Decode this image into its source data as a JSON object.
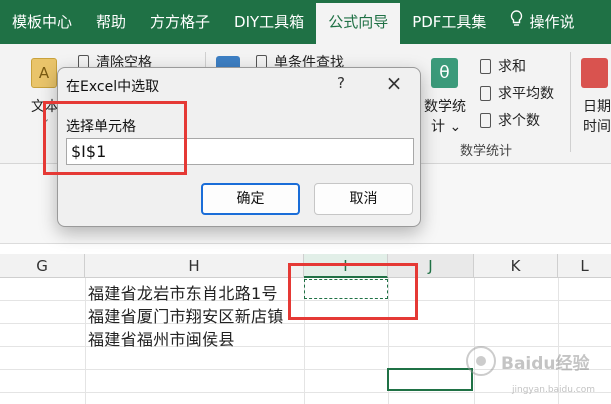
{
  "ribbon_tabs": [
    "模板中心",
    "帮助",
    "方方格子",
    "DIY工具箱",
    "公式向导",
    "PDF工具集",
    "操作说"
  ],
  "active_tab": "公式向导",
  "ribbon": {
    "text_btn": "文本",
    "text_chevron": "⌄",
    "clear_space": "清除空格",
    "single_cond_lookup": "单条件查找",
    "math_stats": "数学统",
    "math_stats_2": "计 ⌄",
    "sum": "求和",
    "average": "求平均数",
    "count": "求个数",
    "group_label": "数学统计",
    "date": "日期",
    "time": "时间"
  },
  "grid": {
    "columns": [
      "G",
      "H",
      "I",
      "J",
      "K",
      "L"
    ],
    "selected_column": "I",
    "rows": [
      "福建省龙岩市东肖北路1号",
      "福建省厦门市翔安区新店镇",
      "福建省福州市闽侯县"
    ]
  },
  "dialog": {
    "title": "在Excel中选取",
    "help": "?",
    "close": "×",
    "label": "选择单元格",
    "value": "$I$1",
    "ok": "确定",
    "cancel": "取消"
  },
  "watermark": {
    "brand": "Baidu经验",
    "url": "jingyan.baidu.com"
  },
  "colors": {
    "excel_green": "#1f7145",
    "annotation_red": "#e53935",
    "focus_blue": "#1a6dd8"
  },
  "icons": [
    "text-icon",
    "clear-space-icon",
    "lookup-icon",
    "theta-icon",
    "sum-icon",
    "average-icon",
    "count-icon",
    "date-icon",
    "bulb-icon"
  ]
}
